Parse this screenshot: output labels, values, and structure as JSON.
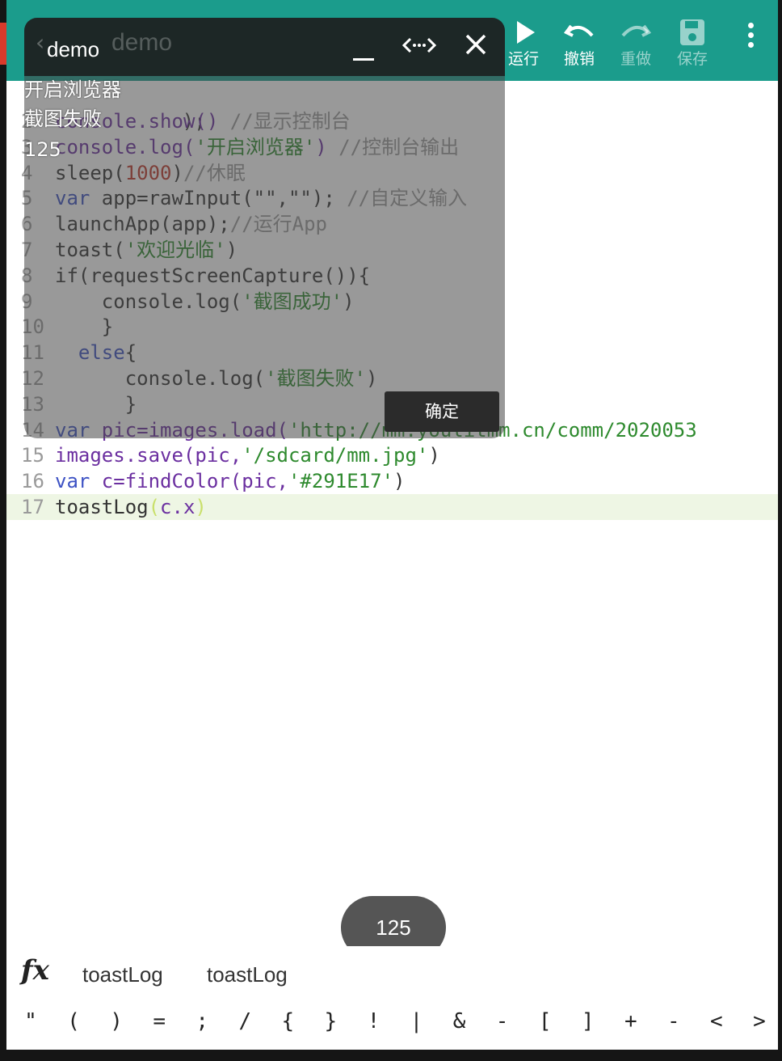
{
  "toolbar": {
    "run_label": "运行",
    "undo_label": "撤销",
    "redo_label": "重做",
    "save_label": "保存"
  },
  "console_window": {
    "title": "demo",
    "ghost_title": "demo",
    "log_lines": [
      "开启浏览器",
      "截图失败",
      "125"
    ]
  },
  "code_lines": [
    {
      "n": "2",
      "tokens": [
        {
          "t": "console.show() ",
          "c": "tk-fn"
        },
        {
          "t": "//显示控制台",
          "c": "tk-cm"
        }
      ]
    },
    {
      "n": "3",
      "tokens": [
        {
          "t": "console.log(",
          "c": "tk-fn"
        },
        {
          "t": "'开启浏览器'",
          "c": "tk-str"
        },
        {
          "t": ") ",
          "c": "tk-fn"
        },
        {
          "t": "//控制台输出",
          "c": "tk-cm"
        }
      ]
    },
    {
      "n": "4",
      "tokens": [
        {
          "t": "sleep(",
          "c": ""
        },
        {
          "t": "1000",
          "c": "tk-num"
        },
        {
          "t": ")",
          "c": ""
        },
        {
          "t": "//休眠",
          "c": "tk-cm"
        }
      ]
    },
    {
      "n": "5",
      "tokens": [
        {
          "t": "var ",
          "c": "tk-kw"
        },
        {
          "t": "app=rawInput(\"\",\"\"); ",
          "c": ""
        },
        {
          "t": "//自定义输入",
          "c": "tk-cm"
        }
      ]
    },
    {
      "n": "6",
      "tokens": [
        {
          "t": "launchApp(app);",
          "c": ""
        },
        {
          "t": "//运行App",
          "c": "tk-cm"
        }
      ]
    },
    {
      "n": "7",
      "tokens": [
        {
          "t": "toast(",
          "c": ""
        },
        {
          "t": "'欢迎光临'",
          "c": "tk-str"
        },
        {
          "t": ")",
          "c": ""
        }
      ]
    },
    {
      "n": "8",
      "tokens": [
        {
          "t": "if(requestScreenCapture()){",
          "c": ""
        }
      ]
    },
    {
      "n": "9",
      "tokens": [
        {
          "t": "    console.log(",
          "c": ""
        },
        {
          "t": "'截图成功'",
          "c": "tk-str"
        },
        {
          "t": ")",
          "c": ""
        }
      ]
    },
    {
      "n": "10",
      "tokens": [
        {
          "t": "    }",
          "c": ""
        }
      ]
    },
    {
      "n": "11",
      "tokens": [
        {
          "t": "  ",
          "c": ""
        },
        {
          "t": "else",
          "c": "tk-kw"
        },
        {
          "t": "{",
          "c": ""
        }
      ]
    },
    {
      "n": "12",
      "tokens": [
        {
          "t": "      console.log(",
          "c": ""
        },
        {
          "t": "'截图失败'",
          "c": "tk-str"
        },
        {
          "t": ")",
          "c": ""
        }
      ]
    },
    {
      "n": "13",
      "tokens": [
        {
          "t": "      }",
          "c": ""
        }
      ]
    },
    {
      "n": "14",
      "tokens": [
        {
          "t": "var ",
          "c": "tk-kw"
        },
        {
          "t": "pic=images.load(",
          "c": "tk-fn"
        },
        {
          "t": "'http://mm.youlitmm.cn/comm/2020053",
          "c": "tk-str"
        }
      ]
    },
    {
      "n": "15",
      "tokens": [
        {
          "t": "images.save(pic,",
          "c": "tk-fn"
        },
        {
          "t": "'/sdcard/mm.jpg'",
          "c": "tk-str"
        },
        {
          "t": ")",
          "c": ""
        }
      ]
    },
    {
      "n": "16",
      "tokens": [
        {
          "t": "var ",
          "c": "tk-kw"
        },
        {
          "t": "c=findColor(pic,",
          "c": "tk-fn"
        },
        {
          "t": "'#291E17'",
          "c": "tk-str"
        },
        {
          "t": ")",
          "c": ""
        }
      ]
    },
    {
      "n": "17",
      "tokens": [
        {
          "t": "toastLog",
          "c": ""
        },
        {
          "t": "(",
          "c": "tk-par"
        },
        {
          "t": "c.x",
          "c": "tk-fn"
        },
        {
          "t": ")",
          "c": "tk-par"
        }
      ]
    }
  ],
  "first_line_partial": ");",
  "dialog": {
    "confirm_label": "确定"
  },
  "toast": {
    "text": "125"
  },
  "autocomplete": {
    "fx_label": "fx",
    "suggestions": [
      "toastLog",
      "toastLog"
    ]
  },
  "symbols": [
    "\"",
    "(",
    ")",
    "=",
    ";",
    "/",
    "{",
    "}",
    "!",
    "|",
    "&",
    "-",
    "[",
    "]",
    "+",
    "-",
    "<",
    ">"
  ],
  "colors": {
    "toolbar": "#1b9c8c",
    "keyword": "#3d52c4",
    "string": "#2e8a2e",
    "number": "#c0392b",
    "comment": "#9a9a9a",
    "active_line": "#eef6e4"
  }
}
